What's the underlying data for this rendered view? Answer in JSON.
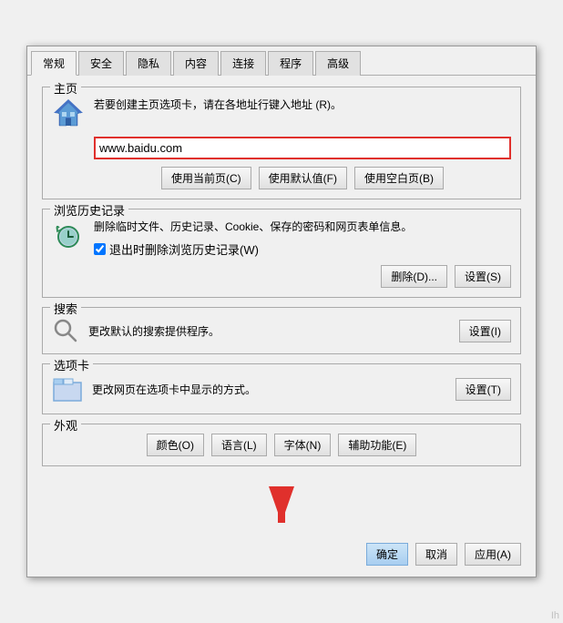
{
  "tabs": [
    {
      "label": "常规",
      "active": true
    },
    {
      "label": "安全"
    },
    {
      "label": "隐私"
    },
    {
      "label": "内容"
    },
    {
      "label": "连接"
    },
    {
      "label": "程序"
    },
    {
      "label": "高级"
    }
  ],
  "homepage": {
    "section_label": "主页",
    "description": "若要创建主页选项卡，请在各地址行键入地址 (R)。",
    "url_value": "www.baidu.com",
    "btn_current": "使用当前页(C)",
    "btn_default": "使用默认值(F)",
    "btn_blank": "使用空白页(B)"
  },
  "history": {
    "section_label": "浏览历史记录",
    "description": "删除临时文件、历史记录、Cookie、保存的密码和网页表单信息。",
    "checkbox_label": "退出时删除浏览历史记录(W)",
    "checkbox_checked": true,
    "btn_delete": "删除(D)...",
    "btn_settings": "设置(S)"
  },
  "search": {
    "section_label": "搜索",
    "description": "更改默认的搜索提供程序。",
    "btn_settings": "设置(I)"
  },
  "optiontabs": {
    "section_label": "选项卡",
    "description": "更改网页在选项卡中显示的方式。",
    "btn_settings": "设置(T)"
  },
  "appearance": {
    "section_label": "外观",
    "btn_color": "颜色(O)",
    "btn_language": "语言(L)",
    "btn_font": "字体(N)",
    "btn_accessibility": "辅助功能(E)"
  },
  "bottom": {
    "btn_ok": "确定",
    "btn_cancel": "取消",
    "btn_apply": "应用(A)",
    "watermark": "Ih"
  }
}
